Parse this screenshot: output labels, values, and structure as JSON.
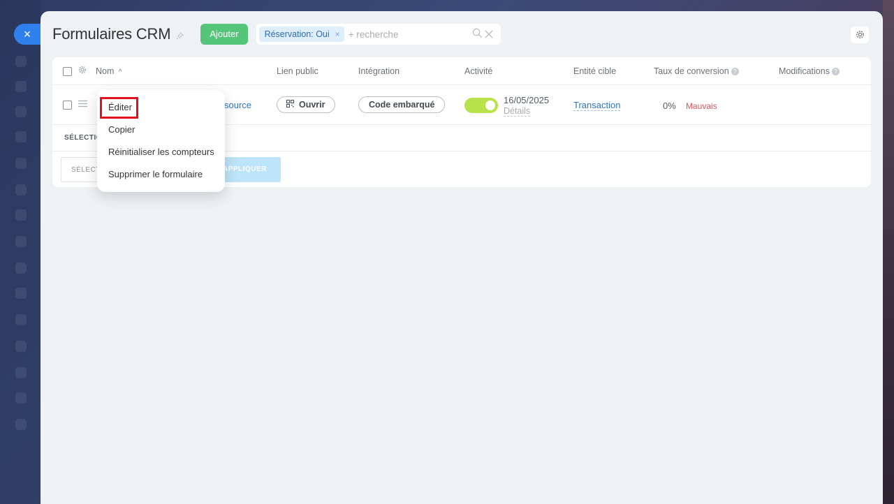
{
  "page": {
    "title": "Formulaires CRM",
    "add_label": "Ajouter",
    "close_glyph": "×"
  },
  "filter": {
    "chip_label": "Réservation: Oui",
    "chip_remove": "×",
    "search_placeholder": "+ recherche"
  },
  "table": {
    "headers": {
      "name": "Nom",
      "public_link": "Lien public",
      "integration": "Intégration",
      "activity": "Activité",
      "target_entity": "Entité cible",
      "conversion_rate": "Taux de conversion",
      "modifications": "Modifications"
    },
    "rows": [
      {
        "name_link": "source",
        "open_label": "Ouvrir",
        "integration_label": "Code embarqué",
        "activity_on": true,
        "date": "16/05/2025",
        "details_label": "Détails",
        "entity": "Transaction",
        "conversion": "0%",
        "conversion_status": "Mauvais"
      }
    ],
    "selected_label": "SÉLECTIO",
    "select_label": "SÉLECT",
    "apply_label": "APPLIQUER"
  },
  "context_menu": {
    "items": [
      {
        "label": "Éditer"
      },
      {
        "label": "Copier"
      },
      {
        "label": "Réinitialiser les compteurs"
      },
      {
        "label": "Supprimer le formulaire"
      }
    ]
  },
  "colors": {
    "accent_blue": "#2f80ed",
    "add_green": "#55c57a",
    "toggle_green": "#b8e34a",
    "highlight_red": "#e0101e",
    "bad_red": "#e65151"
  }
}
